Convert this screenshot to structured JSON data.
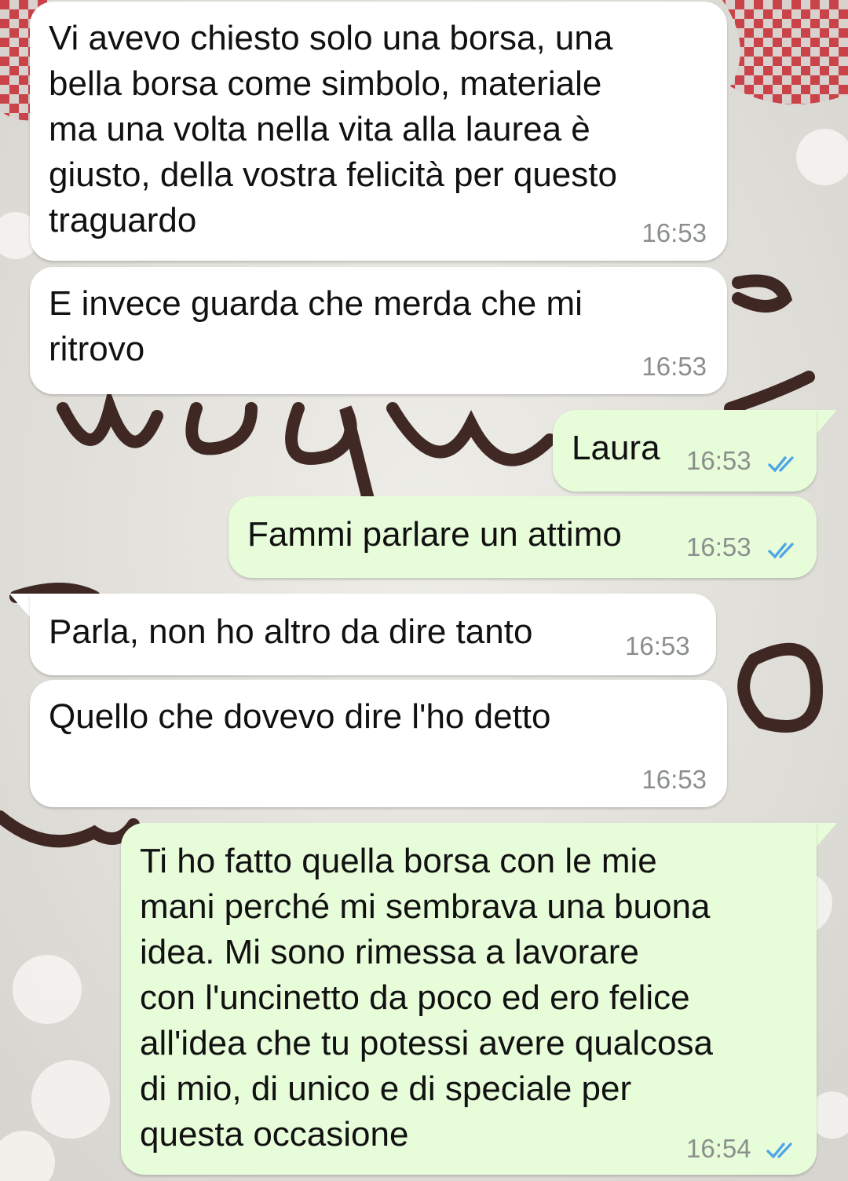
{
  "conversation": {
    "messages": [
      {
        "text": "Vi avevo chiesto solo una borsa, una\nbella borsa come simbolo, materiale\nma una volta nella vita alla laurea è\ngiusto, della vostra felicità per questo\ntraguardo",
        "time": "16:53",
        "direction": "incoming"
      },
      {
        "text": "E invece guarda che merda che mi\nritrovo",
        "time": "16:53",
        "direction": "incoming"
      },
      {
        "text": "Laura",
        "time": "16:53",
        "direction": "outgoing",
        "status": "read"
      },
      {
        "text": "Fammi parlare un attimo",
        "time": "16:53",
        "direction": "outgoing",
        "status": "read"
      },
      {
        "text": "Parla, non ho altro da dire tanto",
        "time": "16:53",
        "direction": "incoming"
      },
      {
        "text": "Quello che dovevo dire l'ho detto",
        "time": "16:53",
        "direction": "incoming"
      },
      {
        "text": "Ti ho fatto quella borsa con le mie\nmani perché mi sembrava una buona\nidea. Mi sono rimessa a lavorare\ncon l'uncinetto da poco ed ero felice\nall'idea che tu potessi avere qualcosa\ndi mio, di unico e di speciale per\nquesta occasione",
        "time": "16:54",
        "direction": "outgoing",
        "status": "read"
      }
    ]
  },
  "colors": {
    "incoming_bubble": "#ffffff",
    "outgoing_bubble": "#e7fcd9",
    "read_tick": "#4fa6e6",
    "timestamp": "#8a8f8c",
    "wallpaper_frosting": "#e6e4de",
    "wallpaper_chocolate": "#2e1410",
    "wallpaper_cloth": "#c8323a"
  },
  "icons": {
    "read_status": "double-check-icon"
  }
}
